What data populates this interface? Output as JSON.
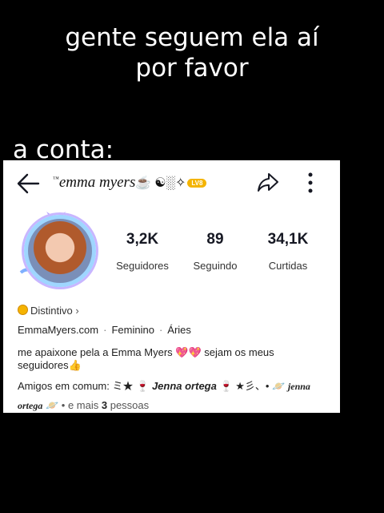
{
  "caption": {
    "line1": "gente seguem ela aí",
    "line2": "por favor",
    "line3": "a conta:"
  },
  "profile": {
    "username": "emma myers",
    "username_prefix": "™",
    "username_deco": "☕ ☯░✧",
    "level_badge": "LV8",
    "stats": [
      {
        "value": "3,2K",
        "label": "Seguidores"
      },
      {
        "value": "89",
        "label": "Seguindo"
      },
      {
        "value": "34,1K",
        "label": "Curtidas"
      }
    ],
    "badge_label": "Distintivo",
    "badge_chevron": "›",
    "website": "EmmaMyers.com",
    "gender": "Feminino",
    "sign": "Áries",
    "bio_line1": "me apaixone pela a Emma Myers 💖💖 sejam os meus",
    "bio_line2": "seguidores👍",
    "friends_prefix": "Amigos em comum:",
    "friend1_deco_left": "ミ★ 🍷",
    "friend1": "Jenna ortega",
    "friend1_deco_right": "🍷 ★彡、• 🪐",
    "friend2": "jenna ortega",
    "friend2_deco": "🪐",
    "more_prefix": "• e mais",
    "more_count": "3",
    "more_suffix": "pessoas"
  },
  "icons": {
    "back": "arrow-left-icon",
    "share": "share-arrow-icon",
    "more": "vertical-dots-icon",
    "badge": "coin-icon"
  },
  "colors": {
    "background": "#000000",
    "caption_text": "#ffffff",
    "card": "#ffffff",
    "coin": "#f5b301"
  }
}
